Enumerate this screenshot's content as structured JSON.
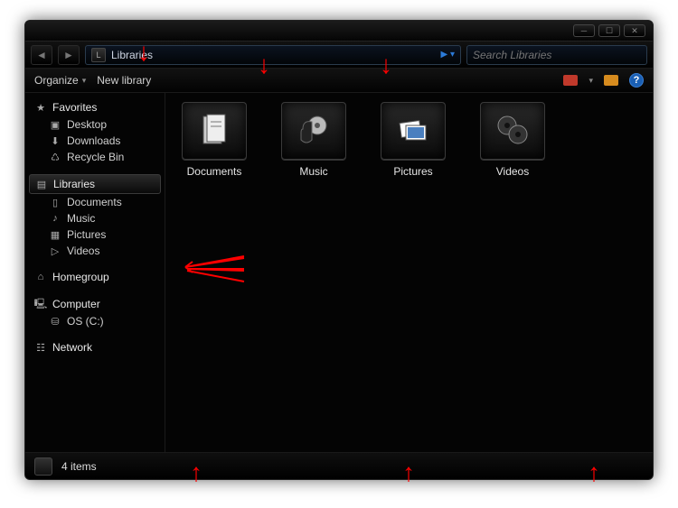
{
  "addressbar": {
    "location": "Libraries",
    "nav_indicator": "▸"
  },
  "search": {
    "placeholder": "Search Libraries"
  },
  "toolbar": {
    "organize": "Organize",
    "newlibrary": "New library"
  },
  "sidebar": {
    "favorites": {
      "label": "Favorites",
      "items": [
        "Desktop",
        "Downloads",
        "Recycle Bin"
      ]
    },
    "libraries": {
      "label": "Libraries",
      "items": [
        "Documents",
        "Music",
        "Pictures",
        "Videos"
      ]
    },
    "homegroup": {
      "label": "Homegroup"
    },
    "computer": {
      "label": "Computer",
      "items": [
        "OS (C:)"
      ]
    },
    "network": {
      "label": "Network"
    }
  },
  "content": {
    "items": [
      {
        "label": "Documents",
        "icon": "documents"
      },
      {
        "label": "Music",
        "icon": "music"
      },
      {
        "label": "Pictures",
        "icon": "pictures"
      },
      {
        "label": "Videos",
        "icon": "videos"
      }
    ]
  },
  "statusbar": {
    "text": "4 items"
  }
}
